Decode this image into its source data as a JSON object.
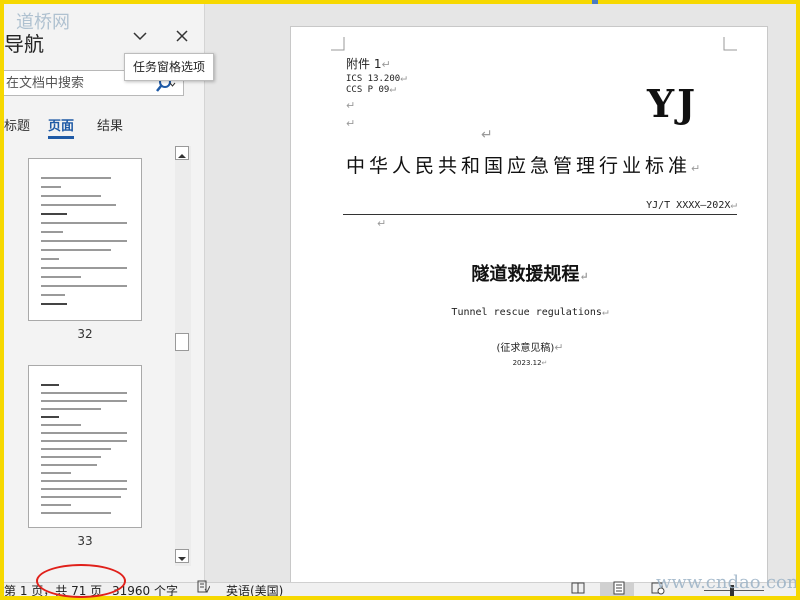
{
  "watermark": {
    "top": "道桥网",
    "bottom": "www.cndao.com"
  },
  "nav": {
    "title": "导航",
    "search_placeholder": "在文档中搜索",
    "tabs": [
      "标题",
      "页面",
      "结果"
    ],
    "active_tab": "页面",
    "thumbnails": [
      {
        "page_label": "32"
      },
      {
        "page_label": "33"
      }
    ],
    "dropdown_icon": "chevron-down-icon",
    "close_icon": "close-icon",
    "search_icon": "magnifier-icon"
  },
  "tooltip": {
    "text": "任务窗格选项"
  },
  "document": {
    "attachment": "附件 1",
    "ics": "ICS 13.200",
    "ccs": "CCS P 09",
    "logo": "YJ",
    "standard_title": "中华人民共和国应急管理行业标准",
    "standard_number": "YJ/T XXXX—202X",
    "title": "隧道救援规程",
    "subtitle_en": "Tunnel rescue regulations",
    "draft_note": "(征求意见稿)",
    "date": "2023.12",
    "paragraph_mark": "↵"
  },
  "status_bar": {
    "page_info": "第 1 页，共 71 页",
    "word_count": "31960 个字",
    "language": "英语(美国)",
    "view_mode": "print-layout"
  },
  "colors": {
    "frame": "#f6d800",
    "accent": "#1f5aa6",
    "annotation_ellipse": "#e0201a"
  }
}
